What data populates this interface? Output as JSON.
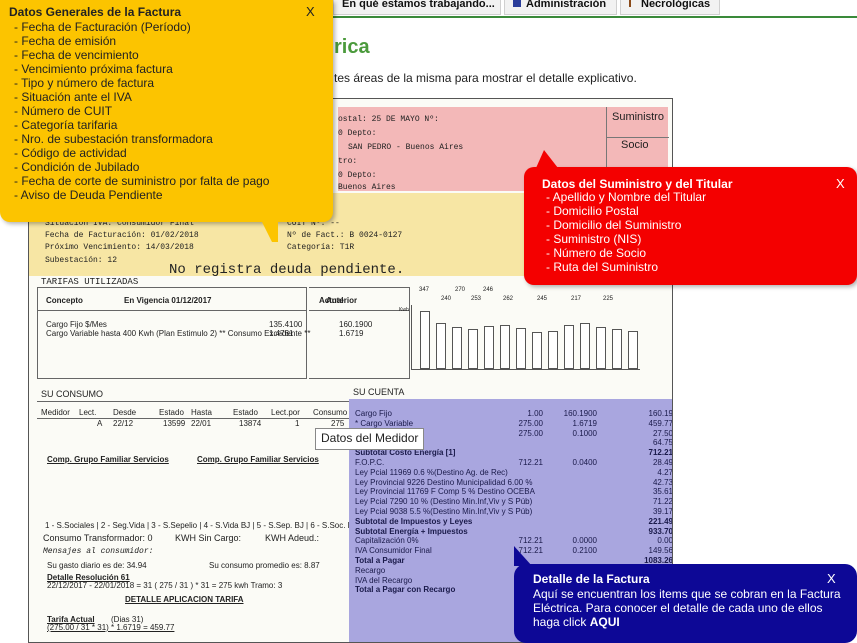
{
  "nav": {
    "tabs": [
      {
        "label": "En qué estamos trabajando..."
      },
      {
        "label": "Administración"
      },
      {
        "label": "Necrológicas"
      }
    ]
  },
  "page": {
    "title": "rica",
    "intro": "tes áreas de la misma para mostrar el detalle explicativo."
  },
  "popups": {
    "general": {
      "title": "Datos Generales de la Factura",
      "close": "X",
      "items": [
        "- Fecha de Facturación (Período)",
        "- Fecha de emisión",
        "- Fecha de vencimiento",
        "- Vencimiento próxima factura",
        "- Tipo y número de factura",
        "- Situación ante el IVA",
        "- Número de CUIT",
        "- Categoría tarifaria",
        "- Nro. de subestación transformadora",
        "- Código de actividad",
        "- Condición de Jubilado",
        "- Fecha de corte de suministro por falta de pago",
        "- Aviso de Deuda Pendiente"
      ]
    },
    "supply": {
      "title": "Datos del Suministro y del Titular",
      "close": "X",
      "items": [
        "- Apellido y Nombre del Titular",
        "- Domicilio Postal",
        "- Domicilio del Suministro",
        "- Suministro (NIS)",
        "- Número de Socio",
        "- Ruta del Suministro"
      ]
    },
    "detail": {
      "title": "Detalle de la Factura",
      "close": "X",
      "text": "Aquí se encuentran los items que se cobran en la Factura Eléctrica. Para conocer el detalle de cada uno de ellos haga click",
      "link": "AQUI"
    },
    "tooltip": "Datos del Medidor"
  },
  "invoice": {
    "header": {
      "postal": "ostal: 25 DE MAYO   Nº:",
      "depto1": "0  Depto:",
      "city1": "SAN PEDRO  - Buenos Aires",
      "tro": "tro:",
      "depto2": "0  Depto:",
      "city2": "Buenos Aires",
      "suministro_label": "Suministro",
      "socio_label": "Socio"
    },
    "general": {
      "iva": "Situación IVA: Consumidor Final",
      "fecha_fact": "Fecha de Facturación: 01/02/2018",
      "prox_venc": "Próximo Vencimiento:   14/03/2018",
      "subestacion": "Subestación: 12",
      "cuit": "CUIT Nº: --",
      "nro_fact": "Nº de Fact.: B 0024-0127",
      "categoria": "Categoría: T1R",
      "deuda": "No registra deuda pendiente."
    },
    "tarifas": {
      "title": "TARIFAS UTILIZADAS",
      "col_concepto": "Concepto",
      "col_vigencia": "En Vigencia  01/12/2017",
      "col_anterior": "Anterior",
      "col_actual": "Actual",
      "row1": "Cargo Fijo $/Mes",
      "row2": "Cargo Variable hasta 400 Kwh (Plan Estimulo 2) ** Consumo Excedente **",
      "ant1": "135.4100",
      "ant2": "1.4761",
      "act1": "160.1900",
      "act2": "1.6719"
    },
    "chart": {
      "top_labels": [
        "347",
        "270",
        "246",
        "240",
        "253",
        "262",
        "245",
        "217",
        "225"
      ],
      "kwh_label": "Kwh"
    },
    "consumo": {
      "title": "SU CONSUMO",
      "headers": [
        "Medidor",
        "Lect.",
        "Desde",
        "Estado",
        "Hasta",
        "Estado",
        "Lect.por",
        "Consumo"
      ],
      "row": [
        "A",
        "22/12",
        "13599",
        "22/01",
        "13874",
        "1",
        "275"
      ],
      "links1": "Comp. Grupo Familiar    Servicios",
      "links2": "Comp. Grupo Familiar    Servicios",
      "codes": "1 - S.Sociales | 2 - Seg.Vida | 3 - S.Sepelio | 4 - S.Vida BJ | 5 - S.Sep. BJ | 6 - S.Soc. BJ",
      "transformador": "Consumo Transformador: 0",
      "sin_cargo": "KWH Sin Cargo:",
      "adeud": "KWH Adeud.:",
      "mensajes": "Mensajes al consumidor:",
      "gasto": "Su gasto diario es de: 34.94",
      "promedio": "Su consumo promedio es: 8.87",
      "det_res": "Detalle Resolución 61",
      "det_formula": "22/12/2017 - 22/01/2018 = 31    ( 275 / 31 ) * 31 = 275 kwh     Tramo: 3",
      "det_tarifa": "DETALLE APLICACION TARIFA",
      "tarifa_actual": "Tarifa Actual",
      "dias": "(Dias 31)",
      "formula": "(275.00 / 31 * 31) * 1.6719 = 459.77"
    },
    "cuenta": {
      "title": "SU CUENTA",
      "lines": [
        {
          "label": "Cargo Fijo",
          "c1": "1.00",
          "c2": "160.1900",
          "c3": "160.19"
        },
        {
          "label": "* Cargo Variable",
          "c1": "275.00",
          "c2": "1.6719",
          "c3": "459.77"
        },
        {
          "label": "s, 208/17)",
          "c1": "275.00",
          "c2": "0.1000",
          "c3": "27.50"
        },
        {
          "label": "(meses anteriores)",
          "c1": "",
          "c2": "",
          "c3": "64.75"
        },
        {
          "label": "Subtotal Costo Energía [1]",
          "c1": "",
          "c2": "",
          "c3": "712.21",
          "bold": true
        },
        {
          "label": "F.O.P.C.",
          "c1": "712.21",
          "c2": "0.0400",
          "c3": "28.49"
        },
        {
          "label": "Ley Pcial 11969 0.6 %(Destino Ag. de Rec)",
          "c1": "",
          "c2": "",
          "c3": "4.27"
        },
        {
          "label": "Ley Provincial 9226 Destino Municipalidad 6.00 %",
          "c1": "",
          "c2": "",
          "c3": "42.73"
        },
        {
          "label": "Ley Provincial 11769 F Comp  5 % Destino OCEBA",
          "c1": "",
          "c2": "",
          "c3": "35.61"
        },
        {
          "label": "Ley Pcial 7290 10 % (Destino Min.Inf,Viv y S Púb)",
          "c1": "",
          "c2": "",
          "c3": "71.22"
        },
        {
          "label": "Ley Pcial 9038 5.5 %(Destino Min.Inf,Viv y S Púb)",
          "c1": "",
          "c2": "",
          "c3": "39.17"
        },
        {
          "label": "Subtotal de Impuestos y Leyes",
          "c1": "",
          "c2": "",
          "c3": "221.49",
          "bold": true
        },
        {
          "label": "Subtotal Energía + Impuestos",
          "c1": "",
          "c2": "",
          "c3": "933.70",
          "bold": true
        },
        {
          "label": "Capitalización 0%",
          "c1": "712.21",
          "c2": "0.0000",
          "c3": "0.00"
        },
        {
          "label": "IVA Consumidor Final",
          "c1": "712.21",
          "c2": "0.2100",
          "c3": "149.56"
        },
        {
          "label": "Total a Pagar",
          "c1": "",
          "c2": "",
          "c3": "1083.26",
          "bold": true
        },
        {
          "label": "Recargo",
          "c1": "10",
          "c2": "",
          "c3": ""
        },
        {
          "label": "IVA del Recargo",
          "c1": "",
          "c2": "",
          "c3": ""
        },
        {
          "label": "Total a Pagar con Recargo",
          "c1": "",
          "c2": "",
          "c3": "",
          "bold": true
        }
      ]
    }
  }
}
